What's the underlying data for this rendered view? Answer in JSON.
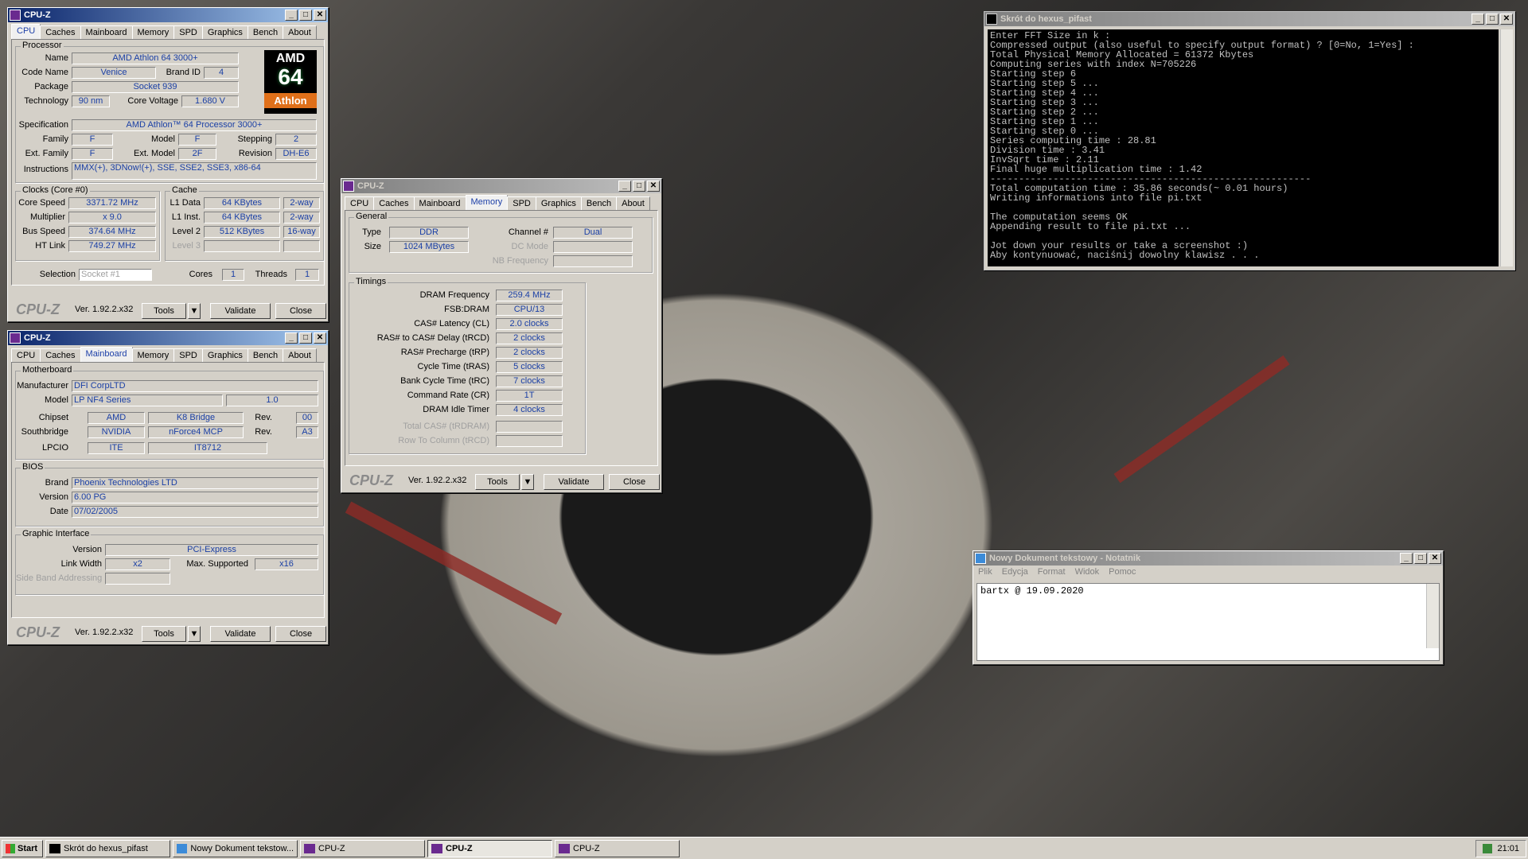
{
  "taskbar": {
    "start": "Start",
    "items": [
      "Skrót do hexus_pifast",
      "Nowy Dokument tekstow...",
      "CPU-Z",
      "CPU-Z",
      "CPU-Z"
    ],
    "clock": "21:01"
  },
  "tabs": [
    "CPU",
    "Caches",
    "Mainboard",
    "Memory",
    "SPD",
    "Graphics",
    "Bench",
    "About"
  ],
  "cpuz_common": {
    "title": "CPU-Z",
    "brand": "CPU-Z",
    "version": "Ver. 1.92.2.x32",
    "tools": "Tools",
    "validate": "Validate",
    "close": "Close"
  },
  "cpu": {
    "processor_label": "Processor",
    "name_l": "Name",
    "name": "AMD Athlon 64 3000+",
    "codename_l": "Code Name",
    "codename": "Venice",
    "brandid_l": "Brand ID",
    "brandid": "4",
    "package_l": "Package",
    "package": "Socket 939",
    "tech_l": "Technology",
    "tech": "90 nm",
    "voltage_l": "Core Voltage",
    "voltage": "1.680 V",
    "spec_l": "Specification",
    "spec": "AMD Athlon™ 64 Processor 3000+",
    "family_l": "Family",
    "family": "F",
    "model_l": "Model",
    "model": "F",
    "stepping_l": "Stepping",
    "stepping": "2",
    "extfamily_l": "Ext. Family",
    "extfamily": "F",
    "extmodel_l": "Ext. Model",
    "extmodel": "2F",
    "revision_l": "Revision",
    "revision": "DH-E6",
    "instr_l": "Instructions",
    "instr": "MMX(+), 3DNow!(+), SSE, SSE2, SSE3, x86-64",
    "clocks_label": "Clocks (Core #0)",
    "corespeed_l": "Core Speed",
    "corespeed": "3371.72 MHz",
    "mult_l": "Multiplier",
    "mult": "x 9.0",
    "bus_l": "Bus Speed",
    "bus": "374.64 MHz",
    "ht_l": "HT Link",
    "ht": "749.27 MHz",
    "cache_label": "Cache",
    "l1d_l": "L1 Data",
    "l1d": "64 KBytes",
    "l1d_w": "2-way",
    "l1i_l": "L1 Inst.",
    "l1i": "64 KBytes",
    "l1i_w": "2-way",
    "l2_l": "Level 2",
    "l2": "512 KBytes",
    "l2_w": "16-way",
    "l3_l": "Level 3",
    "selection_l": "Selection",
    "selection": "Socket #1",
    "cores_l": "Cores",
    "cores": "1",
    "threads_l": "Threads",
    "threads": "1",
    "logo_amd": "AMD",
    "logo_64": "64",
    "logo_athlon": "Athlon"
  },
  "mainboard": {
    "mb_label": "Motherboard",
    "manuf_l": "Manufacturer",
    "manuf": "DFI CorpLTD",
    "model_l": "Model",
    "model": "LP NF4 Series",
    "model_rev": "1.0",
    "chipset_l": "Chipset",
    "chipset_v": "AMD",
    "chipset_n": "K8 Bridge",
    "chipset_rev_l": "Rev.",
    "chipset_rev": "00",
    "south_l": "Southbridge",
    "south_v": "NVIDIA",
    "south_n": "nForce4 MCP",
    "south_rev_l": "Rev.",
    "south_rev": "A3",
    "lpcio_l": "LPCIO",
    "lpcio_v": "ITE",
    "lpcio_n": "IT8712",
    "bios_label": "BIOS",
    "brand_l": "Brand",
    "brand": "Phoenix Technologies LTD",
    "version_l": "Version",
    "version": "6.00 PG",
    "date_l": "Date",
    "date": "07/02/2005",
    "gi_label": "Graphic Interface",
    "giver_l": "Version",
    "giver": "PCI-Express",
    "lw_l": "Link Width",
    "lw": "x2",
    "ms_l": "Max. Supported",
    "ms": "x16",
    "sba_l": "Side Band Addressing"
  },
  "memory": {
    "general_label": "General",
    "type_l": "Type",
    "type": "DDR",
    "channel_l": "Channel #",
    "channel": "Dual",
    "size_l": "Size",
    "size": "1024 MBytes",
    "dcmode_l": "DC Mode",
    "nbfreq_l": "NB Frequency",
    "timings_label": "Timings",
    "rows": [
      {
        "l": "DRAM Frequency",
        "v": "259.4 MHz"
      },
      {
        "l": "FSB:DRAM",
        "v": "CPU/13"
      },
      {
        "l": "CAS# Latency (CL)",
        "v": "2.0 clocks"
      },
      {
        "l": "RAS# to CAS# Delay (tRCD)",
        "v": "2 clocks"
      },
      {
        "l": "RAS# Precharge (tRP)",
        "v": "2 clocks"
      },
      {
        "l": "Cycle Time (tRAS)",
        "v": "5 clocks"
      },
      {
        "l": "Bank Cycle Time (tRC)",
        "v": "7 clocks"
      },
      {
        "l": "Command Rate (CR)",
        "v": "1T"
      },
      {
        "l": "DRAM Idle Timer",
        "v": "4 clocks"
      }
    ],
    "totalcas_l": "Total CAS# (tRDRAM)",
    "rowcol_l": "Row To Column (tRCD)"
  },
  "console": {
    "title": "Skrót do hexus_pifast",
    "text": "Enter FFT Size in k :\nCompressed output (also useful to specify output format) ? [0=No, 1=Yes] :\nTotal Physical Memory Allocated = 61372 Kbytes\nComputing series with index N=705226\nStarting step 6\nStarting step 5 ...\nStarting step 4 ...\nStarting step 3 ...\nStarting step 2 ...\nStarting step 1 ...\nStarting step 0 ...\nSeries computing time : 28.81\nDivision time : 3.41\nInvSqrt time : 2.11\nFinal huge multiplication time : 1.42\n--------------------------------------------------------\nTotal computation time : 35.86 seconds(~ 0.01 hours)\nWriting informations into file pi.txt\n\nThe computation seems OK\nAppending result to file pi.txt ...\n\nJot down your results or take a screenshot :)\nAby kontynuować, naciśnij dowolny klawisz . . ."
  },
  "notepad": {
    "title": "Nowy Dokument tekstowy - Notatnik",
    "menu": [
      "Plik",
      "Edycja",
      "Format",
      "Widok",
      "Pomoc"
    ],
    "content": "bartx @ 19.09.2020"
  }
}
